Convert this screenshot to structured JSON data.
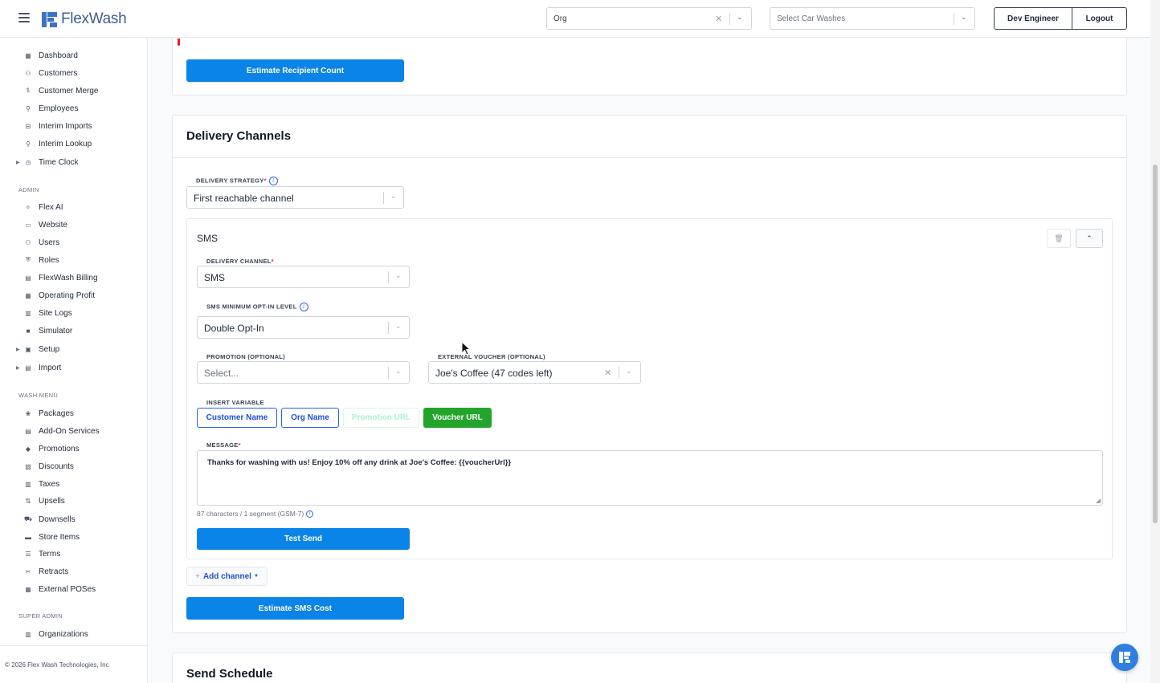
{
  "brand": {
    "name": "FlexWash",
    "color": "#3b73c4"
  },
  "topbar": {
    "org_select": {
      "value": "Org"
    },
    "car_wash_select": {
      "placeholder": "Select Car Washes"
    },
    "user_button": "Dev Engineer",
    "logout_button": "Logout"
  },
  "sidebar": {
    "main_items": [
      {
        "label": "Dashboard",
        "icon": "dashboard-icon"
      },
      {
        "label": "Customers",
        "icon": "customers-icon"
      },
      {
        "label": "Customer Merge",
        "icon": "merge-icon"
      },
      {
        "label": "Employees",
        "icon": "employees-icon"
      },
      {
        "label": "Interim Imports",
        "icon": "imports-icon"
      },
      {
        "label": "Interim Lookup",
        "icon": "lookup-icon"
      },
      {
        "label": "Time Clock",
        "icon": "clock-icon"
      }
    ],
    "admin_title": "ADMIN",
    "admin_items": [
      {
        "label": "Flex AI",
        "icon": "ai-icon"
      },
      {
        "label": "Website",
        "icon": "website-icon"
      },
      {
        "label": "Users",
        "icon": "users-icon"
      },
      {
        "label": "Roles",
        "icon": "roles-icon"
      },
      {
        "label": "FlexWash Billing",
        "icon": "billing-icon"
      },
      {
        "label": "Operating Profit",
        "icon": "profit-icon"
      },
      {
        "label": "Site Logs",
        "icon": "logs-icon"
      },
      {
        "label": "Simulator",
        "icon": "simulator-icon"
      },
      {
        "label": "Setup",
        "icon": "setup-icon"
      },
      {
        "label": "Import",
        "icon": "import-icon"
      }
    ],
    "wash_menu_title": "WASH MENU",
    "wash_items": [
      {
        "label": "Packages",
        "icon": "packages-icon"
      },
      {
        "label": "Add-On Services",
        "icon": "addon-icon"
      },
      {
        "label": "Promotions",
        "icon": "promotions-icon"
      },
      {
        "label": "Discounts",
        "icon": "discounts-icon"
      },
      {
        "label": "Taxes",
        "icon": "taxes-icon"
      },
      {
        "label": "Upsells",
        "icon": "upsells-icon"
      },
      {
        "label": "Downsells",
        "icon": "downsells-icon"
      },
      {
        "label": "Store Items",
        "icon": "store-icon"
      },
      {
        "label": "Terms",
        "icon": "terms-icon"
      },
      {
        "label": "Retracts",
        "icon": "retracts-icon"
      },
      {
        "label": "External POSes",
        "icon": "pos-icon"
      }
    ],
    "super_admin_title": "SUPER ADMIN",
    "super_items": [
      {
        "label": "Organizations",
        "icon": "organizations-icon"
      }
    ],
    "footer": "© 2026 Flex Wash Technologies, Inc"
  },
  "estimate_recipient_button": "Estimate Recipient Count",
  "delivery": {
    "title": "Delivery Channels",
    "strategy_label": "DELIVERY STRATEGY",
    "strategy_value": "First reachable channel",
    "channel": {
      "name": "SMS",
      "channel_label": "DELIVERY CHANNEL",
      "channel_value": "SMS",
      "optin_label": "SMS MINIMUM OPT-IN LEVEL",
      "optin_value": "Double Opt-In",
      "promotion_label": "PROMOTION (OPTIONAL)",
      "promotion_placeholder": "Select...",
      "voucher_label": "EXTERNAL VOUCHER (OPTIONAL)",
      "voucher_value": "Joe's Coffee (47 codes left)",
      "insert_variable_label": "INSERT VARIABLE",
      "variables": [
        "Customer Name",
        "Org Name",
        "Promotion URL",
        "Voucher URL"
      ],
      "message_label": "MESSAGE",
      "message_value": "Thanks for washing with us! Enjoy 10% off any drink at Joe's Coffee: {{voucherUrl}}",
      "char_count": "87 characters / 1 segment (GSM-7)",
      "test_send_button": "Test Send"
    },
    "add_channel_button": "Add channel",
    "estimate_sms_button": "Estimate SMS Cost"
  },
  "schedule": {
    "title": "Send Schedule"
  },
  "colors": {
    "primary": "#0a84e8",
    "success": "#22a52a",
    "danger": "#dc2626"
  }
}
